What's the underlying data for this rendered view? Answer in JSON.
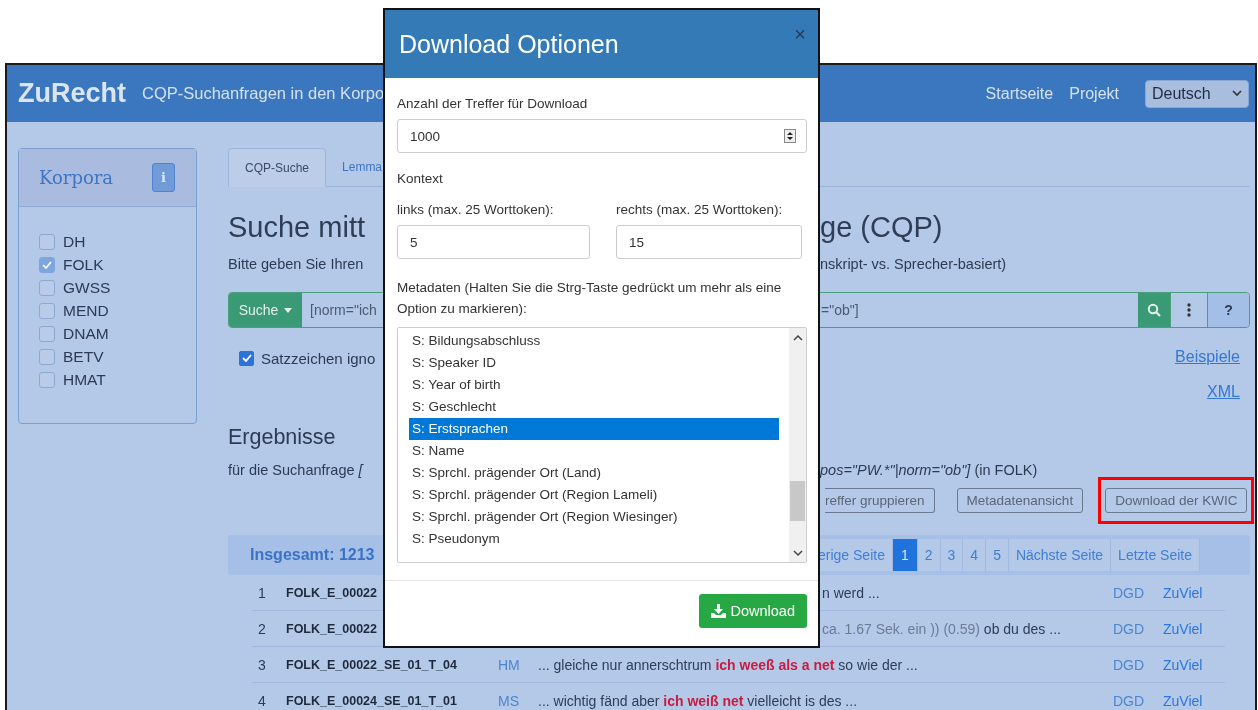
{
  "navbar": {
    "brand": "ZuRecht",
    "subtitle": "CQP-Suchanfragen in den Korpo",
    "links": [
      "Startseite",
      "Projekt"
    ],
    "language": "Deutsch"
  },
  "sidebar": {
    "title": "Korpora",
    "info": "i",
    "corpora": [
      {
        "label": "DH",
        "checked": false
      },
      {
        "label": "FOLK",
        "checked": true
      },
      {
        "label": "GWSS",
        "checked": false
      },
      {
        "label": "MEND",
        "checked": false
      },
      {
        "label": "DNAM",
        "checked": false
      },
      {
        "label": "BETV",
        "checked": false
      },
      {
        "label": "HMAT",
        "checked": false
      }
    ]
  },
  "tabs": [
    {
      "label": "CQP-Suche",
      "selected": true
    },
    {
      "label": "Lemma",
      "selected": false
    }
  ],
  "heading": {
    "left": "Suche mitt",
    "right": "ge (CQP)"
  },
  "intro": {
    "left": "Bitte geben Sie Ihren",
    "right": "nskript- vs. Sprecher-basiert)"
  },
  "search": {
    "button": "Suche",
    "query_left": "[norm=\"ich",
    "query_right": "=\"ob\"]",
    "help": "?"
  },
  "ignore_punctuation": {
    "label": "Satzzeichen igno",
    "checked": true
  },
  "links": [
    "Beispiele",
    "XML"
  ],
  "results": {
    "title": "Ergebnisse",
    "query_prefix": "für die Suchanfrage",
    "query_left": "[",
    "query_right": "pos=\"PW.*\"|norm=\"ob\"]",
    "corpus_note": "(in FOLK)",
    "buttons": [
      {
        "label": "reffer gruppieren",
        "highlighted": false
      },
      {
        "label": "Metadatenansicht",
        "highlighted": false
      },
      {
        "label": "Download der KWIC",
        "highlighted": true
      }
    ],
    "total": "Insgesamt: 1213",
    "pages": [
      {
        "label": "erige Seite",
        "selected": false
      },
      {
        "label": "1",
        "selected": true
      },
      {
        "label": "2",
        "selected": false
      },
      {
        "label": "3",
        "selected": false
      },
      {
        "label": "4",
        "selected": false
      },
      {
        "label": "5",
        "selected": false
      },
      {
        "label": "Nächste Seite",
        "selected": false
      },
      {
        "label": "Letzte Seite",
        "selected": false
      }
    ],
    "rows": [
      {
        "number": "1",
        "id": "FOLK_E_00022",
        "covered": true,
        "segments": [
          {
            "kind": "plain",
            "text": "n werd ..."
          }
        ],
        "source": "DGD",
        "action": "ZuViel"
      },
      {
        "number": "2",
        "id": "FOLK_E_00022",
        "covered": true,
        "segments": [
          {
            "kind": "pause",
            "text": "ca. 1.67 Sek. ein )) (0.59)"
          },
          {
            "kind": "plain",
            "text": " ob du des ..."
          }
        ],
        "source": "DGD",
        "action": "ZuViel"
      },
      {
        "number": "3",
        "id": "FOLK_E_00022_SE_01_T_04",
        "speaker": "HM",
        "covered": false,
        "segments": [
          {
            "kind": "plain",
            "text": "... gleiche nur annerschtrum "
          },
          {
            "kind": "match",
            "text": "ich weeß als a net"
          },
          {
            "kind": "plain",
            "text": " so wie der ..."
          }
        ],
        "source": "DGD",
        "action": "ZuViel"
      },
      {
        "number": "4",
        "id": "FOLK_E_00024_SE_01_T_01",
        "speaker": "MS",
        "covered": false,
        "segments": [
          {
            "kind": "plain",
            "text": "... wichtig fänd aber "
          },
          {
            "kind": "match",
            "text": "ich weiß net"
          },
          {
            "kind": "plain",
            "text": " vielleicht is des ..."
          }
        ],
        "source": "DGD",
        "action": "ZuViel"
      }
    ]
  },
  "modal": {
    "title": "Download Optionen",
    "close": "×",
    "count_label": "Anzahl der Treffer für Download",
    "count": "1000",
    "context_label": "Kontext",
    "left_label": "links (max. 25 Worttoken):",
    "left_value": "5",
    "right_label": "rechts (max. 25 Worttoken):",
    "right_value": "15",
    "metadata_label": "Metadaten (Halten Sie die Strg-Taste gedrückt um mehr als eine Option zu markieren):",
    "options": [
      {
        "label": "S: Bildungsabschluss",
        "selected": false
      },
      {
        "label": "S: Speaker ID",
        "selected": false
      },
      {
        "label": "S: Year of birth",
        "selected": false
      },
      {
        "label": "S: Geschlecht",
        "selected": false
      },
      {
        "label": "S: Erstsprachen",
        "selected": true
      },
      {
        "label": "S: Name",
        "selected": false
      },
      {
        "label": "S: Sprchl. prägender Ort (Land)",
        "selected": false
      },
      {
        "label": "S: Sprchl. prägender Ort (Region Lameli)",
        "selected": false
      },
      {
        "label": "S: Sprchl. prägender Ort (Region Wiesinger)",
        "selected": false
      },
      {
        "label": "S: Pseudonym",
        "selected": false
      }
    ],
    "download": "Download"
  }
}
